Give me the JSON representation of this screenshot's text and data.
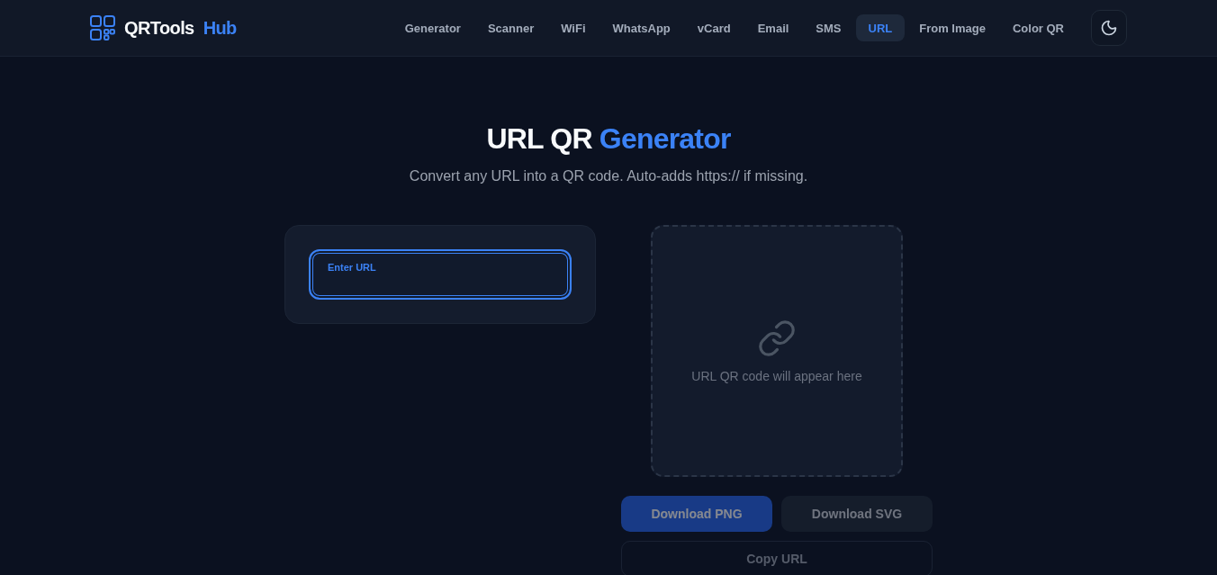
{
  "header": {
    "logo": {
      "text": "QRTools",
      "accent": "Hub"
    },
    "nav": [
      {
        "label": "Generator",
        "selected": false
      },
      {
        "label": "Scanner",
        "selected": false
      },
      {
        "label": "WiFi",
        "selected": false
      },
      {
        "label": "WhatsApp",
        "selected": false
      },
      {
        "label": "vCard",
        "selected": false
      },
      {
        "label": "Email",
        "selected": false
      },
      {
        "label": "SMS",
        "selected": false
      },
      {
        "label": "URL",
        "selected": true
      },
      {
        "label": "From Image",
        "selected": false
      },
      {
        "label": "Color QR",
        "selected": false
      }
    ]
  },
  "hero": {
    "title": "URL QR",
    "title_accent": "Generator",
    "subtitle": "Convert any URL into a QR code. Auto-adds https:// if missing."
  },
  "form": {
    "url_field": {
      "label": "Enter URL",
      "focused": true
    }
  },
  "preview": {
    "empty_message": "URL QR code will appear here"
  },
  "actions": [
    {
      "kind": "primary",
      "label": "Download PNG",
      "disabled": true
    },
    {
      "kind": "secondary",
      "label": "Download SVG",
      "disabled": true
    },
    {
      "kind": "outline",
      "label": "Copy URL",
      "disabled": true
    }
  ]
}
